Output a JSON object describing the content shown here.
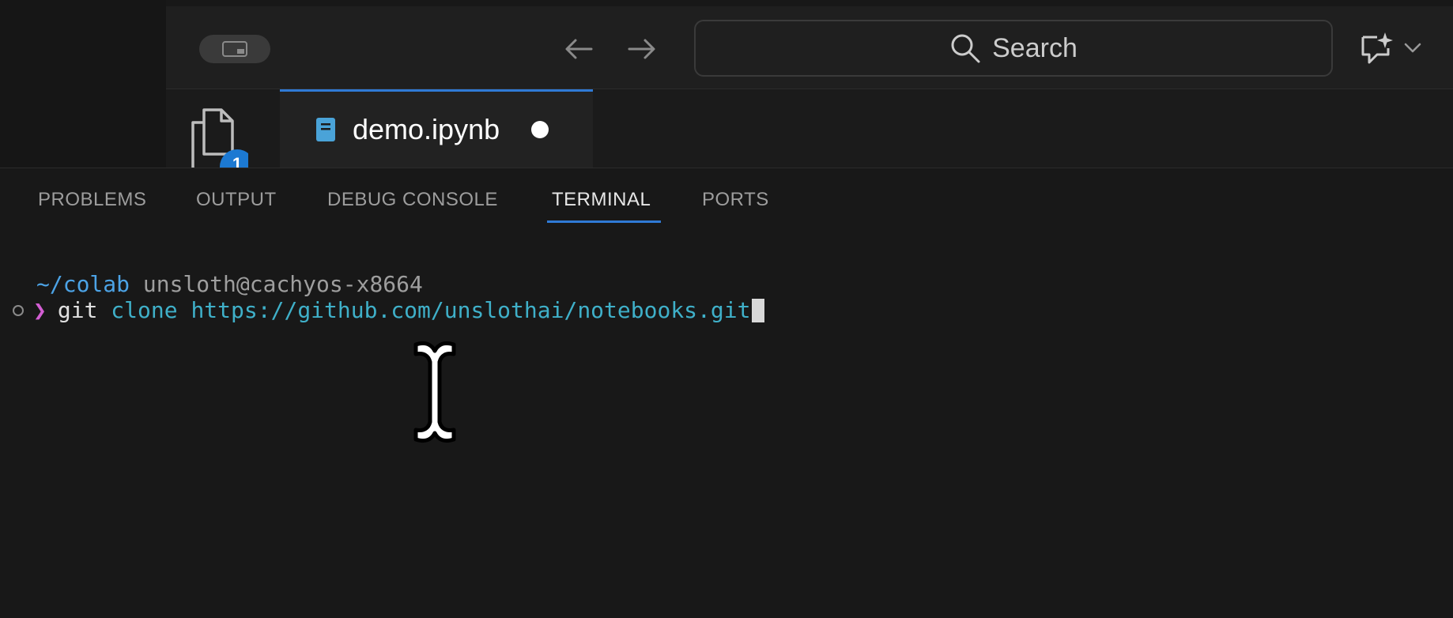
{
  "titlebar": {
    "search_label": "Search"
  },
  "tabs": [
    {
      "label": "demo.ipynb",
      "dirty": true
    }
  ],
  "explorer": {
    "badge_count": "1"
  },
  "panel": {
    "tabs": [
      {
        "label": "PROBLEMS",
        "active": false
      },
      {
        "label": "OUTPUT",
        "active": false
      },
      {
        "label": "DEBUG CONSOLE",
        "active": false
      },
      {
        "label": "TERMINAL",
        "active": true
      },
      {
        "label": "PORTS",
        "active": false
      }
    ]
  },
  "terminal": {
    "prompt_dir": "~/colab",
    "prompt_user": "unsloth@cachyos-x8664",
    "chevron": "❯",
    "command": "git",
    "subcommand": "clone",
    "argument": "https://github.com/unslothai/notebooks.git"
  },
  "colors": {
    "accent": "#2f7ad6",
    "badge": "#1c79d2",
    "prompt_dir": "#4ca3e6",
    "chevron": "#d35ed3",
    "command_arg": "#3fb0c9"
  },
  "icons": {
    "layout": "layout-toggle-icon",
    "back": "arrow-left-icon",
    "forward": "arrow-right-icon",
    "search": "search-icon",
    "copilot": "copilot-chat-icon",
    "dropdown": "chevron-down-icon",
    "explorer": "files-icon",
    "notebook": "notebook-file-icon",
    "cursor": "ibeam-cursor-icon"
  }
}
